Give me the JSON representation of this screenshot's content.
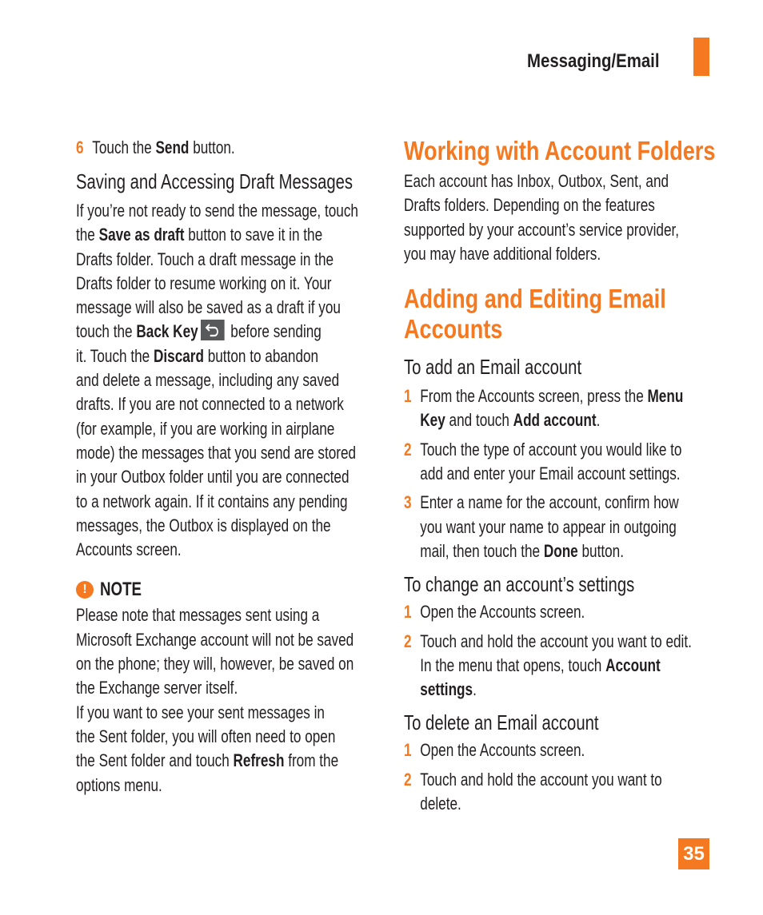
{
  "header": {
    "section_title": "Messaging/Email"
  },
  "left": {
    "step6": {
      "number": "6",
      "pre": "Touch the ",
      "bold": "Send",
      "post": " button."
    },
    "subheading": "Saving and Accessing Draft Messages",
    "para_lines": [
      "If you’re not ready to send the message, touch",
      "",
      "",
      "",
      "",
      "",
      "",
      "and delete a message, including any saved",
      "drafts. If you are not connected to a network",
      "(for example, if you are working in airplane",
      "mode) the messages that you send are stored",
      "in your Outbox folder until you are connected",
      "to a network again. If it contains any pending",
      "messages, the Outbox is displayed on the",
      "Accounts screen."
    ],
    "line2": {
      "pre": "the ",
      "bold": "Save as draft",
      "post": " button to save it in the"
    },
    "line3": "Drafts folder. Touch a draft message in the",
    "line4": "Drafts folder to resume working on it. Your",
    "line5": "message will also be saved as a draft if you",
    "line6": {
      "pre": "touch the ",
      "bold": "Back Key",
      "post": " before sending"
    },
    "line7": {
      "pre": "it. Touch the ",
      "bold": "Discard",
      "post": " button to abandon"
    },
    "note": {
      "icon": "!",
      "title": "NOTE",
      "lines": [
        "Please note that messages sent using a",
        "Microsoft Exchange account will not be saved",
        "on the phone; they will, however, be saved on",
        "the Exchange server itself.",
        "If you want to see your sent messages in",
        "the Sent folder, you will often need to open"
      ],
      "refresh_line": {
        "pre": "the Sent folder and touch ",
        "bold": "Refresh",
        "post": " from the"
      },
      "last_line": "options menu."
    }
  },
  "right": {
    "heading1": "Working with Account Folders",
    "folders_lines": [
      "Each account has Inbox, Outbox, Sent, and",
      "Drafts folders. Depending on the features",
      "supported by your account’s service provider,",
      "you may have additional folders."
    ],
    "heading2_lines": [
      "Adding and Editing Email",
      "Accounts"
    ],
    "add": {
      "title": "To add an Email account",
      "s1a": {
        "num": "1",
        "pre": "From the Accounts screen, press the ",
        "bold": "Menu"
      },
      "s1b": {
        "bold1": "Key",
        "mid": " and touch ",
        "bold2": "Add account",
        "post": "."
      },
      "s2a": {
        "num": "2",
        "text": "Touch the type of account you would like to"
      },
      "s2b": "add and enter your Email account settings.",
      "s3a": {
        "num": "3",
        "text": "Enter a name for the account, confirm how"
      },
      "s3b": "you want your name to appear in outgoing",
      "s3c": {
        "pre": "mail, then touch the ",
        "bold": "Done",
        "post": " button."
      }
    },
    "change": {
      "title": "To change an account’s settings",
      "s1": {
        "num": "1",
        "text": "Open the Accounts screen."
      },
      "s2a": {
        "num": "2",
        "text": "Touch and hold the account you want to edit."
      },
      "s2b": {
        "pre": "In the menu that opens, touch ",
        "bold": "Account"
      },
      "s2c": {
        "bold": "settings",
        "post": "."
      }
    },
    "delete": {
      "title": "To delete an Email account",
      "s1": {
        "num": "1",
        "text": "Open the Accounts screen."
      },
      "s2a": {
        "num": "2",
        "text": "Touch and hold the account you want to"
      },
      "s2b": "delete."
    }
  },
  "footer": {
    "page_number": "35"
  },
  "colors": {
    "accent": "#f47920",
    "text": "#231f20",
    "key_bg": "#58595b"
  }
}
